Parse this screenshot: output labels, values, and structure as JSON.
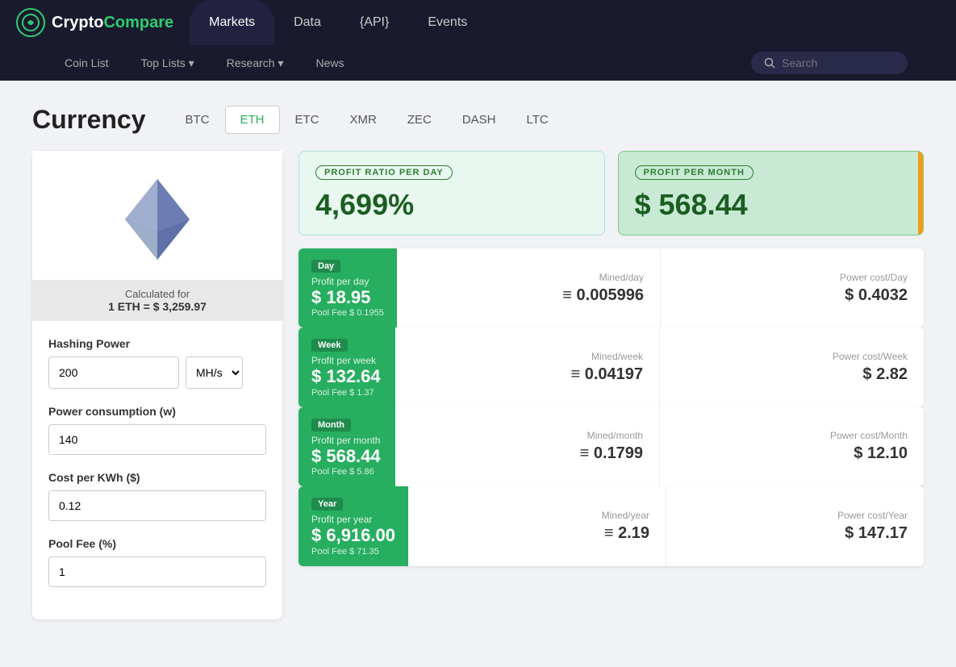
{
  "brand": {
    "logo_text_1": "Crypto",
    "logo_text_2": "Compare",
    "logo_icon": "₿"
  },
  "top_nav": {
    "items": [
      {
        "label": "Markets",
        "active": true
      },
      {
        "label": "Data",
        "active": false
      },
      {
        "label": "{API}",
        "active": false
      },
      {
        "label": "Events",
        "active": false
      }
    ]
  },
  "secondary_nav": {
    "items": [
      {
        "label": "Coin List"
      },
      {
        "label": "Top Lists ▾"
      },
      {
        "label": "Research ▾"
      },
      {
        "label": "News"
      }
    ],
    "search_placeholder": "Search"
  },
  "page": {
    "title": "Currency",
    "tabs": [
      {
        "label": "BTC",
        "active": false
      },
      {
        "label": "ETH",
        "active": true
      },
      {
        "label": "ETC",
        "active": false
      },
      {
        "label": "XMR",
        "active": false
      },
      {
        "label": "ZEC",
        "active": false
      },
      {
        "label": "DASH",
        "active": false
      },
      {
        "label": "LTC",
        "active": false
      }
    ]
  },
  "left_panel": {
    "calc_label": "Calculated for",
    "calc_value": "1 ETH = $ 3,259.97",
    "hashing_power_label": "Hashing Power",
    "hashing_power_value": "200",
    "hashing_power_unit": "MH/s",
    "power_consumption_label": "Power consumption (w)",
    "power_consumption_value": "140",
    "cost_per_kwh_label": "Cost per KWh ($)",
    "cost_per_kwh_value": "0.12",
    "pool_fee_label": "Pool Fee (%)",
    "pool_fee_value": "1"
  },
  "stats": {
    "profit_ratio_label": "PROFIT RATIO PER DAY",
    "profit_ratio_value": "4,699%",
    "profit_month_label": "PROFIT PER MONTH",
    "profit_month_value": "$ 568.44"
  },
  "rows": [
    {
      "period": "Day",
      "profit_label": "Profit per day",
      "profit_value": "$ 18.95",
      "pool_fee": "Pool Fee $ 0.1955",
      "mined_label": "Mined/day",
      "mined_value": "≡ 0.005996",
      "power_label": "Power cost/Day",
      "power_value": "$ 0.4032"
    },
    {
      "period": "Week",
      "profit_label": "Profit per week",
      "profit_value": "$ 132.64",
      "pool_fee": "Pool Fee $ 1.37",
      "mined_label": "Mined/week",
      "mined_value": "≡ 0.04197",
      "power_label": "Power cost/Week",
      "power_value": "$ 2.82"
    },
    {
      "period": "Month",
      "profit_label": "Profit per month",
      "profit_value": "$ 568.44",
      "pool_fee": "Pool Fee $ 5.86",
      "mined_label": "Mined/month",
      "mined_value": "≡ 0.1799",
      "power_label": "Power cost/Month",
      "power_value": "$ 12.10"
    },
    {
      "period": "Year",
      "profit_label": "Profit per year",
      "profit_value": "$ 6,916.00",
      "pool_fee": "Pool Fee $ 71.35",
      "mined_label": "Mined/year",
      "mined_value": "≡ 2.19",
      "power_label": "Power cost/Year",
      "power_value": "$ 147.17"
    }
  ]
}
